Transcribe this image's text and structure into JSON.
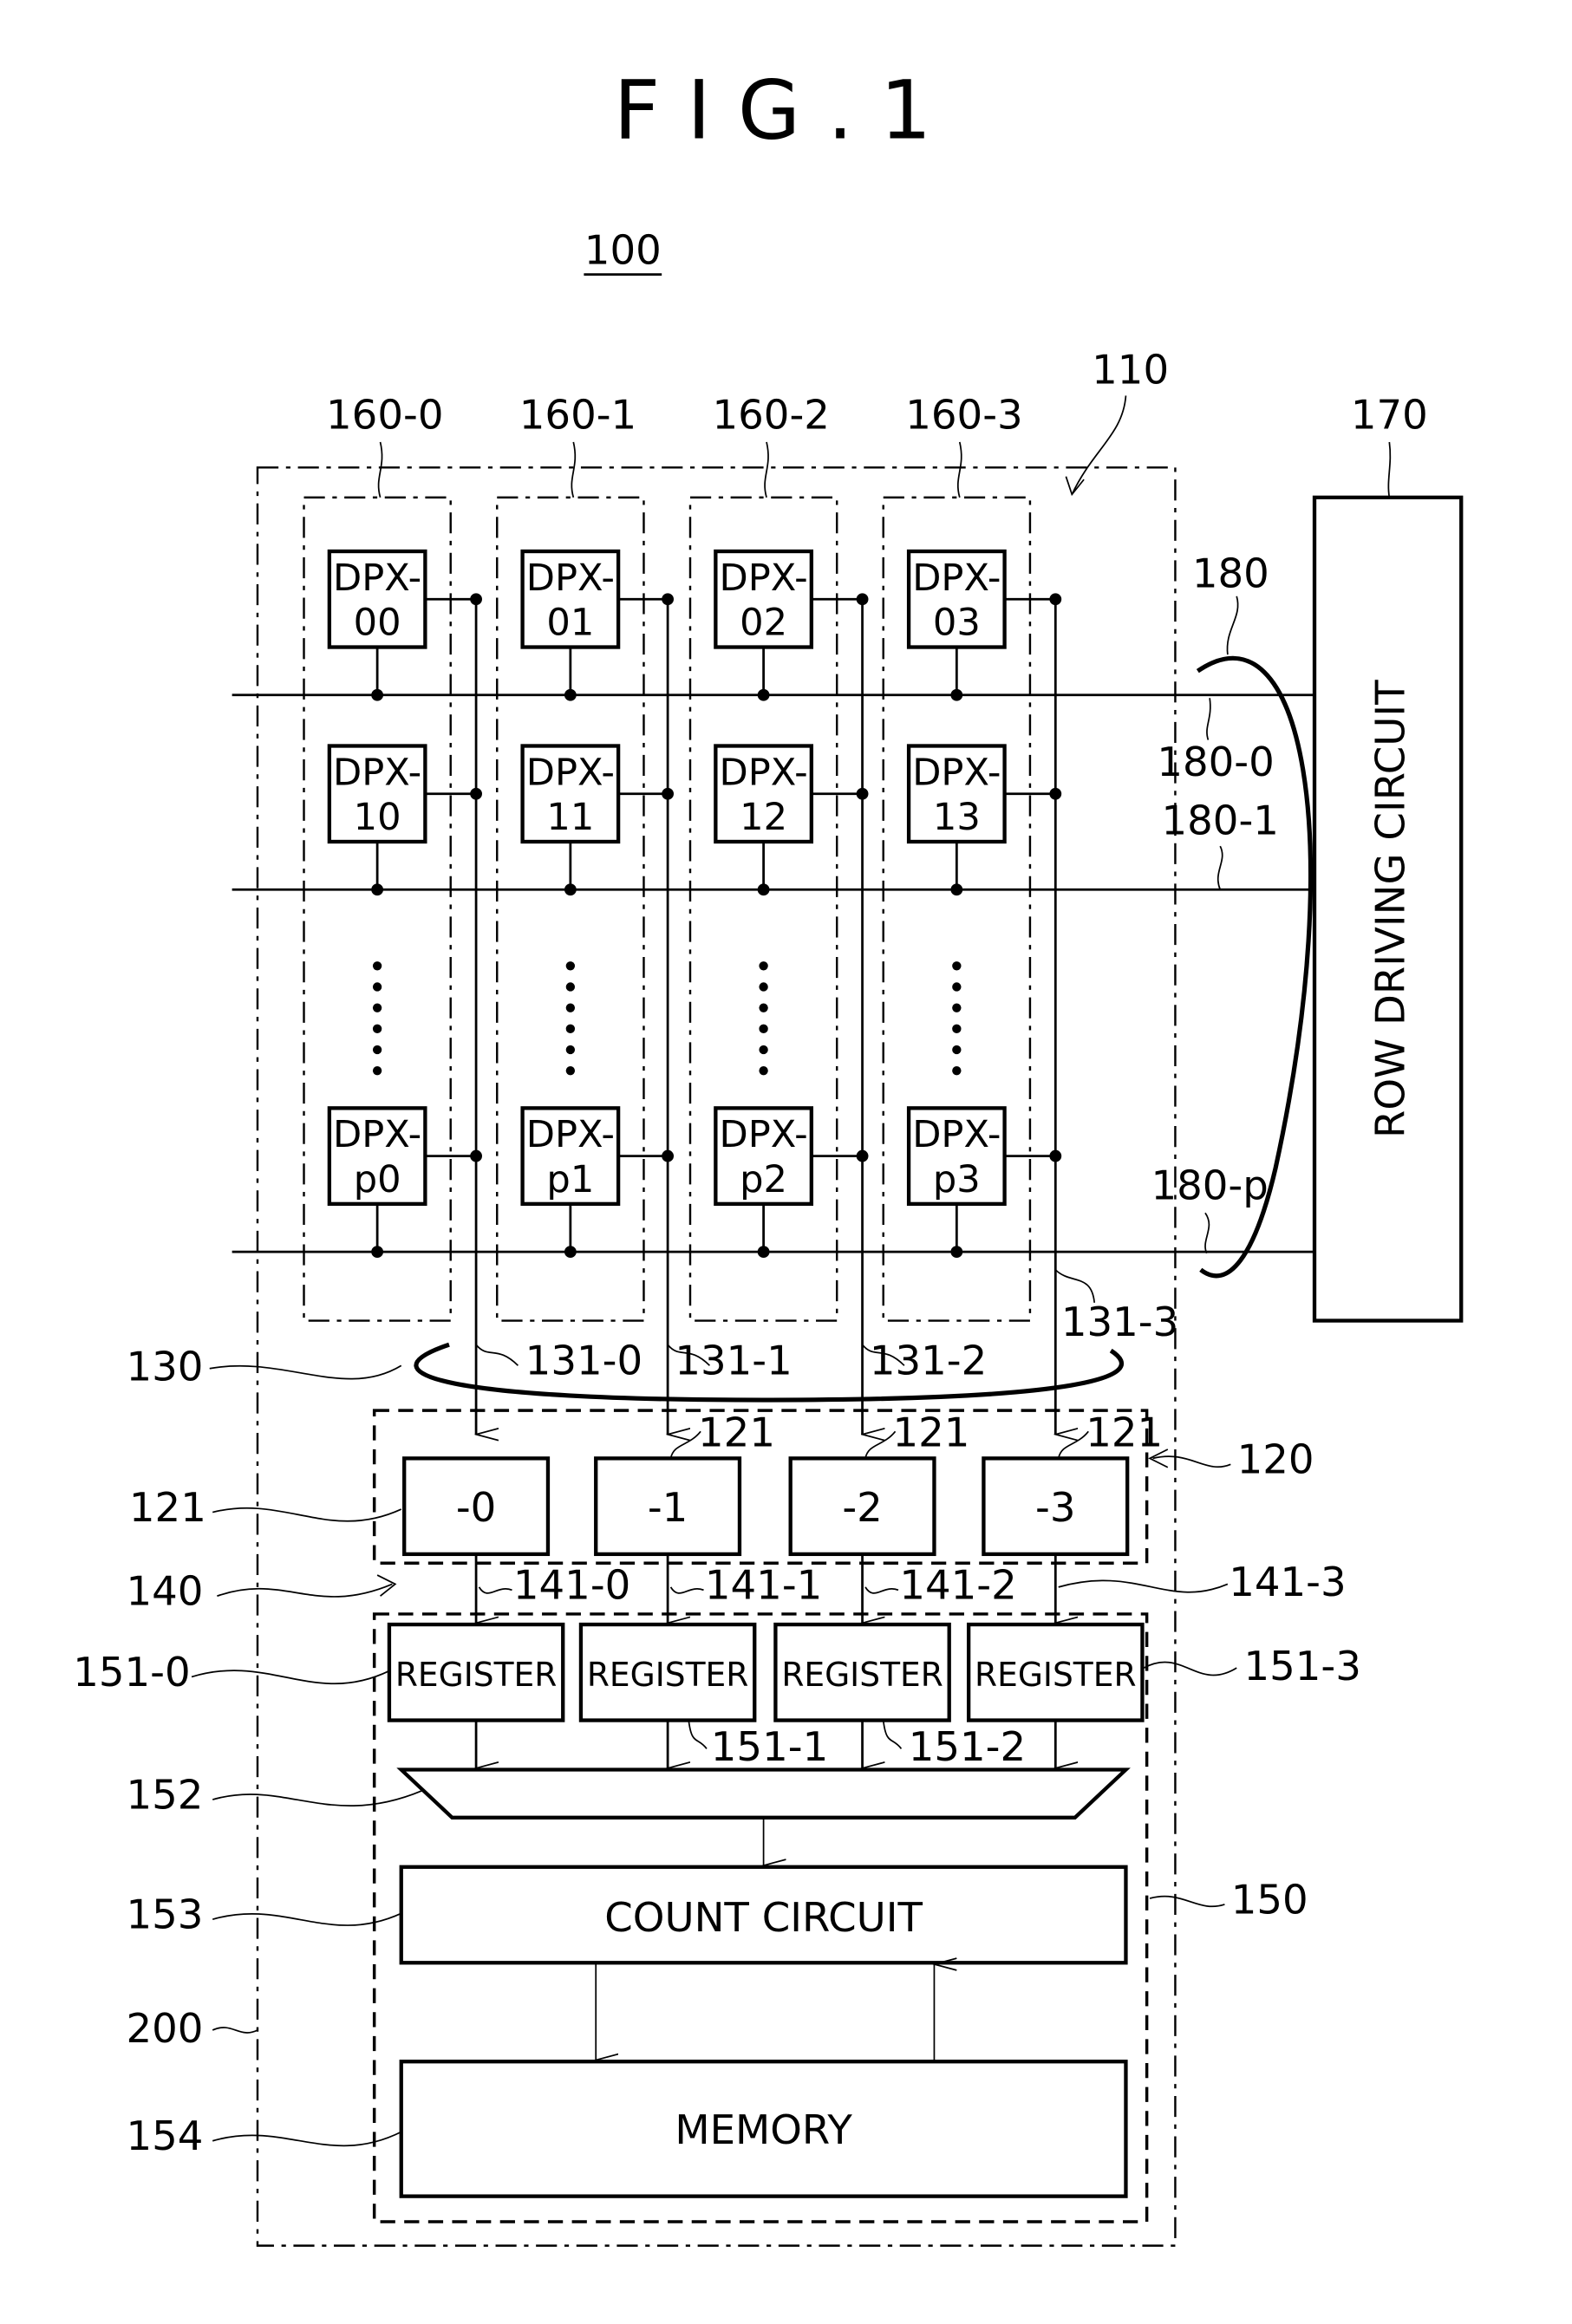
{
  "figure": {
    "title": "FIG.1",
    "device_ref": "100"
  },
  "labels": {
    "pixel_array": "110",
    "column_groups": [
      "160-0",
      "160-1",
      "160-2",
      "160-3"
    ],
    "row_driving_ref": "170",
    "row_lines_group": "180",
    "row_line_0": "180-0",
    "row_line_1": "180-1",
    "row_line_p": "180-p",
    "signal_lines_group": "130",
    "signal_lines": [
      "131-0",
      "131-1",
      "131-2",
      "131-3"
    ],
    "tdc_group": "120",
    "tdc_unit": "121",
    "tdc_unit_refs": [
      "121",
      "121",
      "121"
    ],
    "wiring_group": "140",
    "wirings": [
      "141-0",
      "141-1",
      "141-2",
      "141-3"
    ],
    "registers": [
      "151-0",
      "151-1",
      "151-2",
      "151-3"
    ],
    "selector": "152",
    "count_circuit_ref": "153",
    "memory_ref": "154",
    "processing_group": "150",
    "chip": "200"
  },
  "pixels": [
    [
      "DPX-|00",
      "DPX-|01",
      "DPX-|02",
      "DPX-|03"
    ],
    [
      "DPX-|10",
      "DPX-|11",
      "DPX-|12",
      "DPX-|13"
    ],
    [
      "DPX-|p0",
      "DPX-|p1",
      "DPX-|p2",
      "DPX-|p3"
    ]
  ],
  "pixel_top": "DPX-",
  "pixel_ids": [
    [
      "00",
      "01",
      "02",
      "03"
    ],
    [
      "10",
      "11",
      "12",
      "13"
    ],
    [
      "p0",
      "p1",
      "p2",
      "p3"
    ]
  ],
  "tdc_boxes": [
    "-0",
    "-1",
    "-2",
    "-3"
  ],
  "register_label": "REGISTER",
  "blocks": {
    "row_driving_circuit": "ROW DRIVING CIRCUIT",
    "count_circuit": "COUNT CIRCUIT",
    "memory": "MEMORY"
  }
}
